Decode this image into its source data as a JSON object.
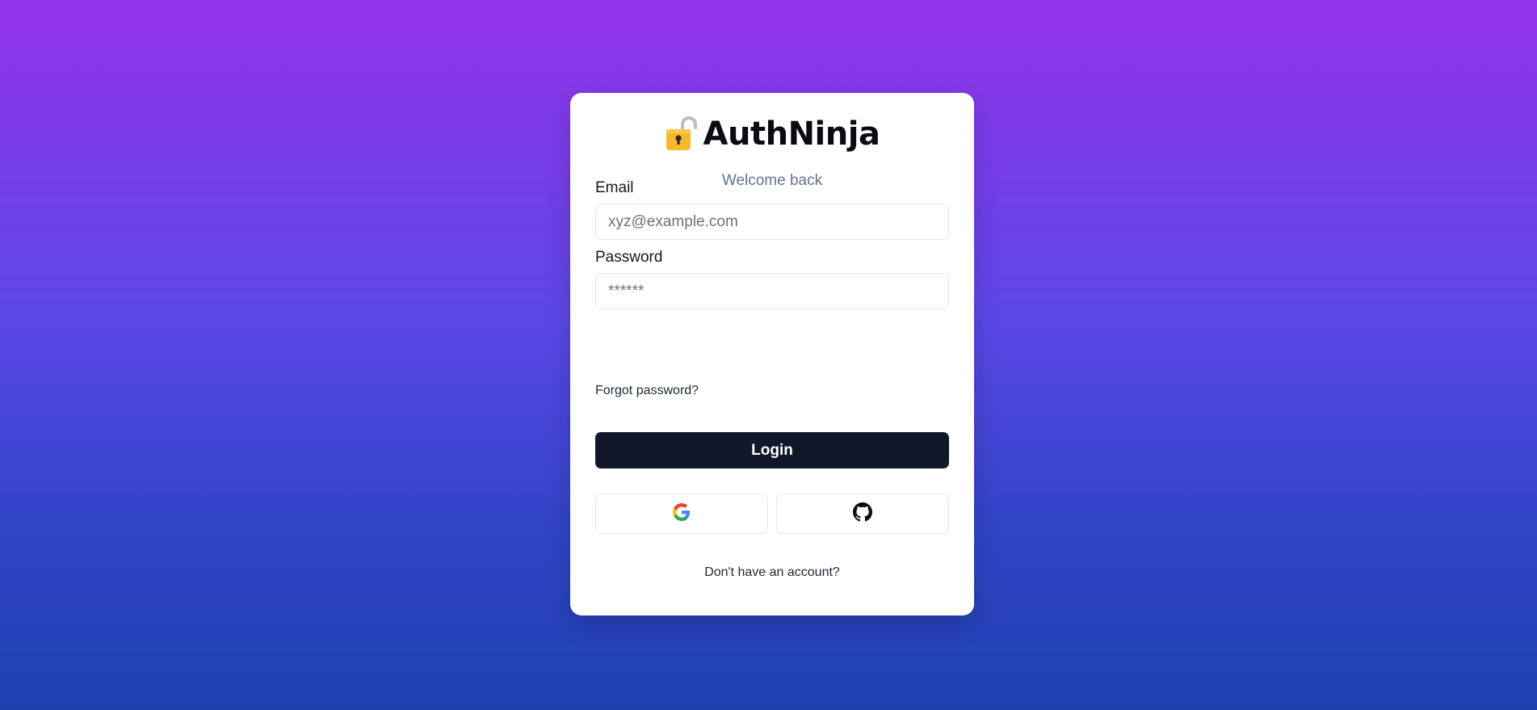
{
  "brand": {
    "title": "AuthNinja",
    "icon": "lock-icon",
    "subtitle": "Welcome back"
  },
  "form": {
    "email": {
      "label": "Email",
      "value": "",
      "placeholder": "xyz@example.com"
    },
    "password": {
      "label": "Password",
      "value": "",
      "placeholder": "******"
    },
    "forgot_label": "Forgot password?",
    "login_label": "Login"
  },
  "social": {
    "google_icon": "google-icon",
    "github_icon": "github-icon"
  },
  "footer": {
    "signup_label": "Don't have an account?"
  },
  "colors": {
    "gradient_top": "#9333ea",
    "gradient_bottom": "#1e40af",
    "primary_button": "#0f1729",
    "card_background": "#ffffff"
  }
}
